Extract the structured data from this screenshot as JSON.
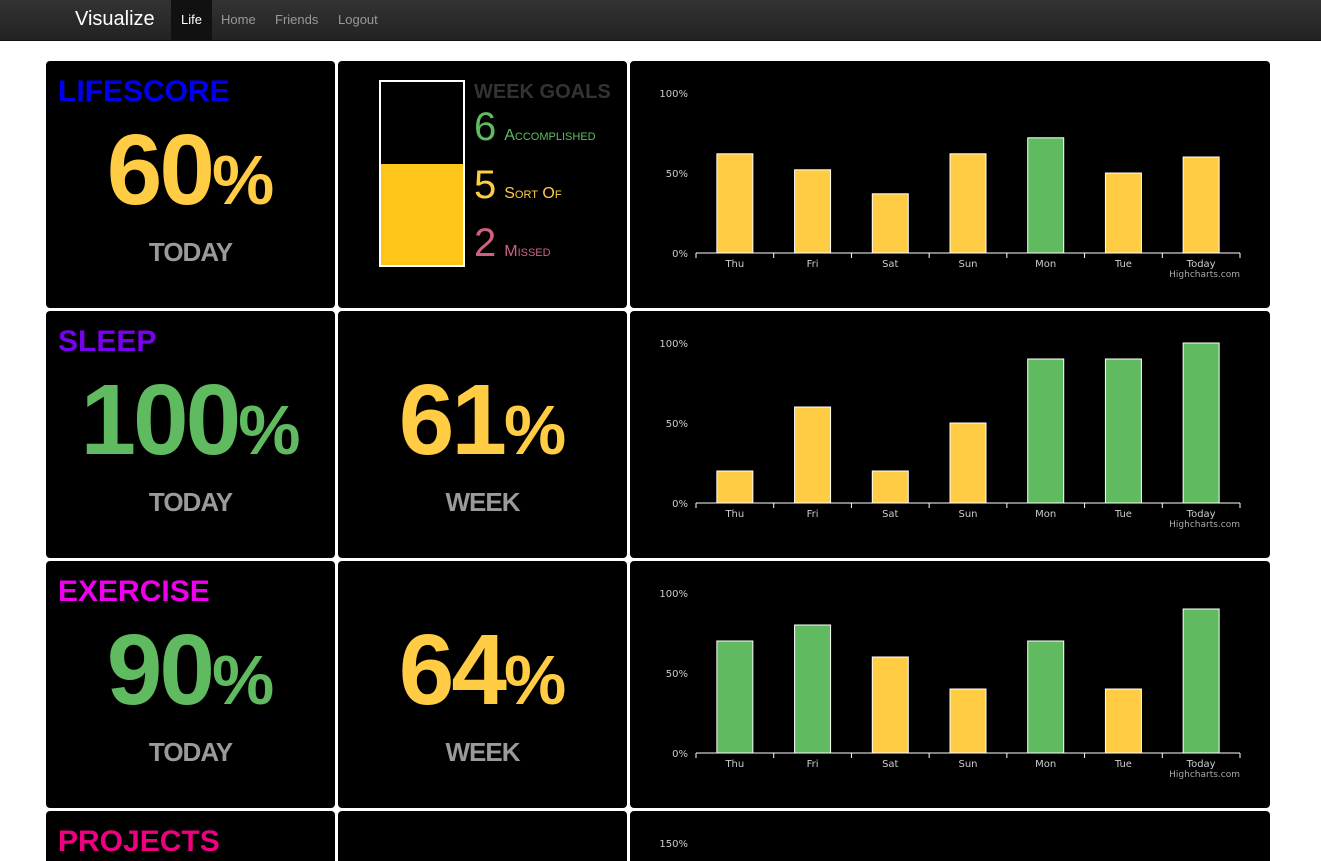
{
  "nav": {
    "brand": "Visualize",
    "items": [
      "Life",
      "Home",
      "Friends",
      "Logout"
    ],
    "active": "Life"
  },
  "colors": {
    "green": "#60BB60",
    "yellow": "#FFCC44",
    "pink": "#D06080",
    "gray_label": "#9A9A9A",
    "lifescore_title": "#0000EE",
    "sleep_title": "#7A00F0",
    "exercise_title": "#EE00EE",
    "projects_title": "#EE0080"
  },
  "rows": [
    {
      "title": "LIFESCORE",
      "today": {
        "value": "60",
        "pct": "%",
        "label": "TODAY",
        "color": "yellow"
      },
      "week_goals": {
        "title": "WEEK GOALS",
        "fill_fraction": 0.55,
        "items": [
          {
            "count": "6",
            "label": "Accomplished",
            "color": "green"
          },
          {
            "count": "5",
            "label": "Sort Of",
            "color": "yellow"
          },
          {
            "count": "2",
            "label": "Missed",
            "color": "pink"
          }
        ]
      }
    },
    {
      "title": "SLEEP",
      "today": {
        "value": "100",
        "pct": "%",
        "label": "TODAY",
        "color": "green"
      },
      "week": {
        "value": "61",
        "pct": "%",
        "label": "WEEK",
        "color": "yellow"
      }
    },
    {
      "title": "EXERCISE",
      "today": {
        "value": "90",
        "pct": "%",
        "label": "TODAY",
        "color": "green"
      },
      "week": {
        "value": "64",
        "pct": "%",
        "label": "WEEK",
        "color": "yellow"
      }
    },
    {
      "title": "PROJECTS"
    }
  ],
  "chart_data": [
    {
      "type": "bar",
      "categories": [
        "Thu",
        "Fri",
        "Sat",
        "Sun",
        "Mon",
        "Tue",
        "Today"
      ],
      "values": [
        62,
        52,
        37,
        62,
        72,
        50,
        60
      ],
      "colors": [
        "yellow",
        "yellow",
        "yellow",
        "yellow",
        "green",
        "yellow",
        "yellow"
      ],
      "ylim": [
        0,
        100
      ],
      "yticks": [
        "100%",
        "50%",
        "0%"
      ],
      "credit": "Highcharts.com"
    },
    {
      "type": "bar",
      "categories": [
        "Thu",
        "Fri",
        "Sat",
        "Sun",
        "Mon",
        "Tue",
        "Today"
      ],
      "values": [
        20,
        60,
        20,
        50,
        90,
        90,
        100
      ],
      "colors": [
        "yellow",
        "yellow",
        "yellow",
        "yellow",
        "green",
        "green",
        "green"
      ],
      "ylim": [
        0,
        100
      ],
      "yticks": [
        "100%",
        "50%",
        "0%"
      ],
      "credit": "Highcharts.com"
    },
    {
      "type": "bar",
      "categories": [
        "Thu",
        "Fri",
        "Sat",
        "Sun",
        "Mon",
        "Tue",
        "Today"
      ],
      "values": [
        70,
        80,
        60,
        40,
        70,
        40,
        90
      ],
      "colors": [
        "green",
        "green",
        "yellow",
        "yellow",
        "green",
        "yellow",
        "green"
      ],
      "ylim": [
        0,
        100
      ],
      "yticks": [
        "100%",
        "50%",
        "0%"
      ],
      "credit": "Highcharts.com"
    },
    {
      "type": "bar",
      "categories": [],
      "values": [],
      "yticks": [
        "150%"
      ]
    }
  ]
}
